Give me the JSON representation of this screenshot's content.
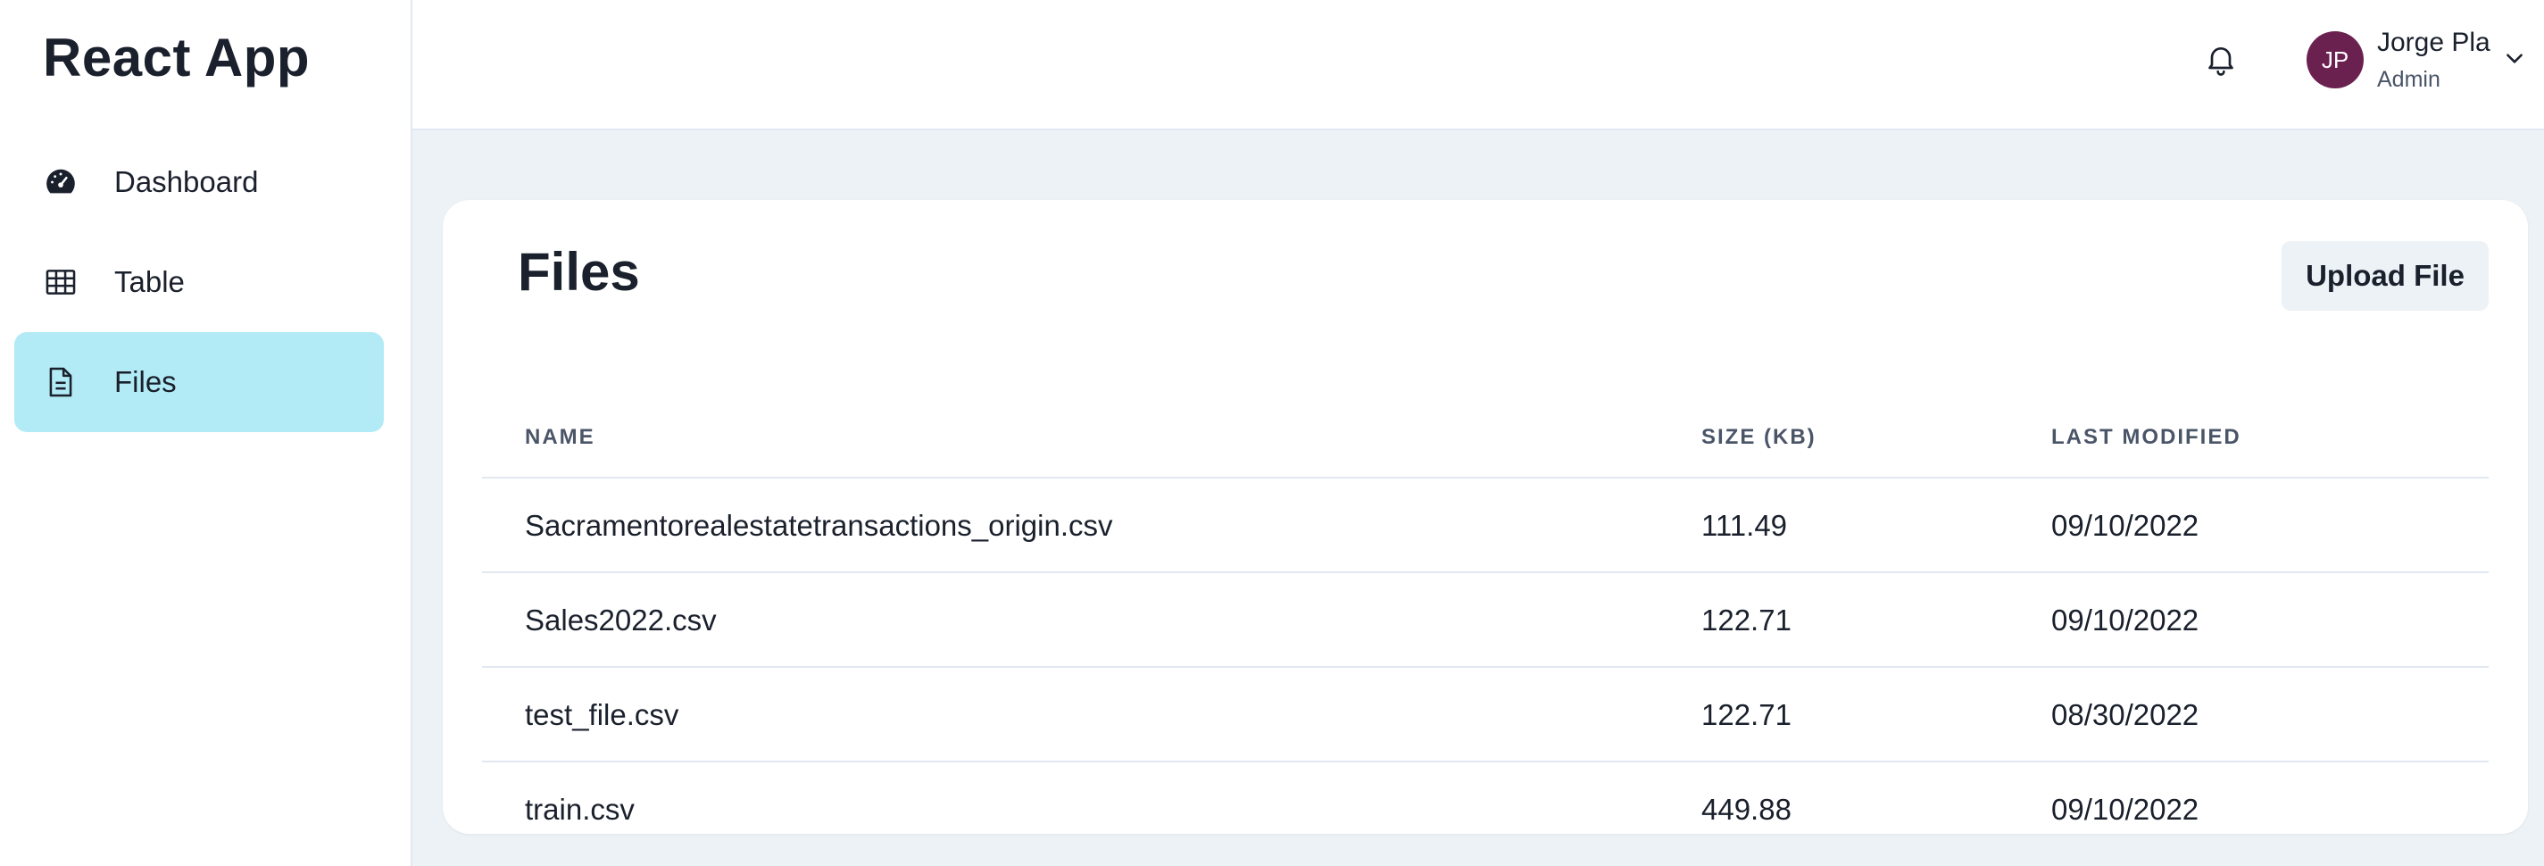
{
  "sidebar": {
    "app_title": "React App",
    "items": [
      {
        "label": "Dashboard",
        "icon": "gauge-icon"
      },
      {
        "label": "Table",
        "icon": "table-icon"
      },
      {
        "label": "Files",
        "icon": "file-icon",
        "active": true
      }
    ]
  },
  "header": {
    "user": {
      "initials": "JP",
      "name": "Jorge Pla",
      "role": "Admin"
    },
    "colors": {
      "avatar": "#6b2150",
      "active_nav": "#b2ebf5"
    }
  },
  "main": {
    "title": "Files",
    "upload_label": "Upload File",
    "table": {
      "columns": [
        "NAME",
        "SIZE (KB)",
        "LAST MODIFIED"
      ],
      "rows": [
        {
          "name": "Sacramentorealestatetransactions_origin.csv",
          "size": "111.49",
          "modified": "09/10/2022"
        },
        {
          "name": "Sales2022.csv",
          "size": "122.71",
          "modified": "09/10/2022"
        },
        {
          "name": "test_file.csv",
          "size": "122.71",
          "modified": "08/30/2022"
        },
        {
          "name": "train.csv",
          "size": "449.88",
          "modified": "09/10/2022"
        }
      ]
    }
  }
}
